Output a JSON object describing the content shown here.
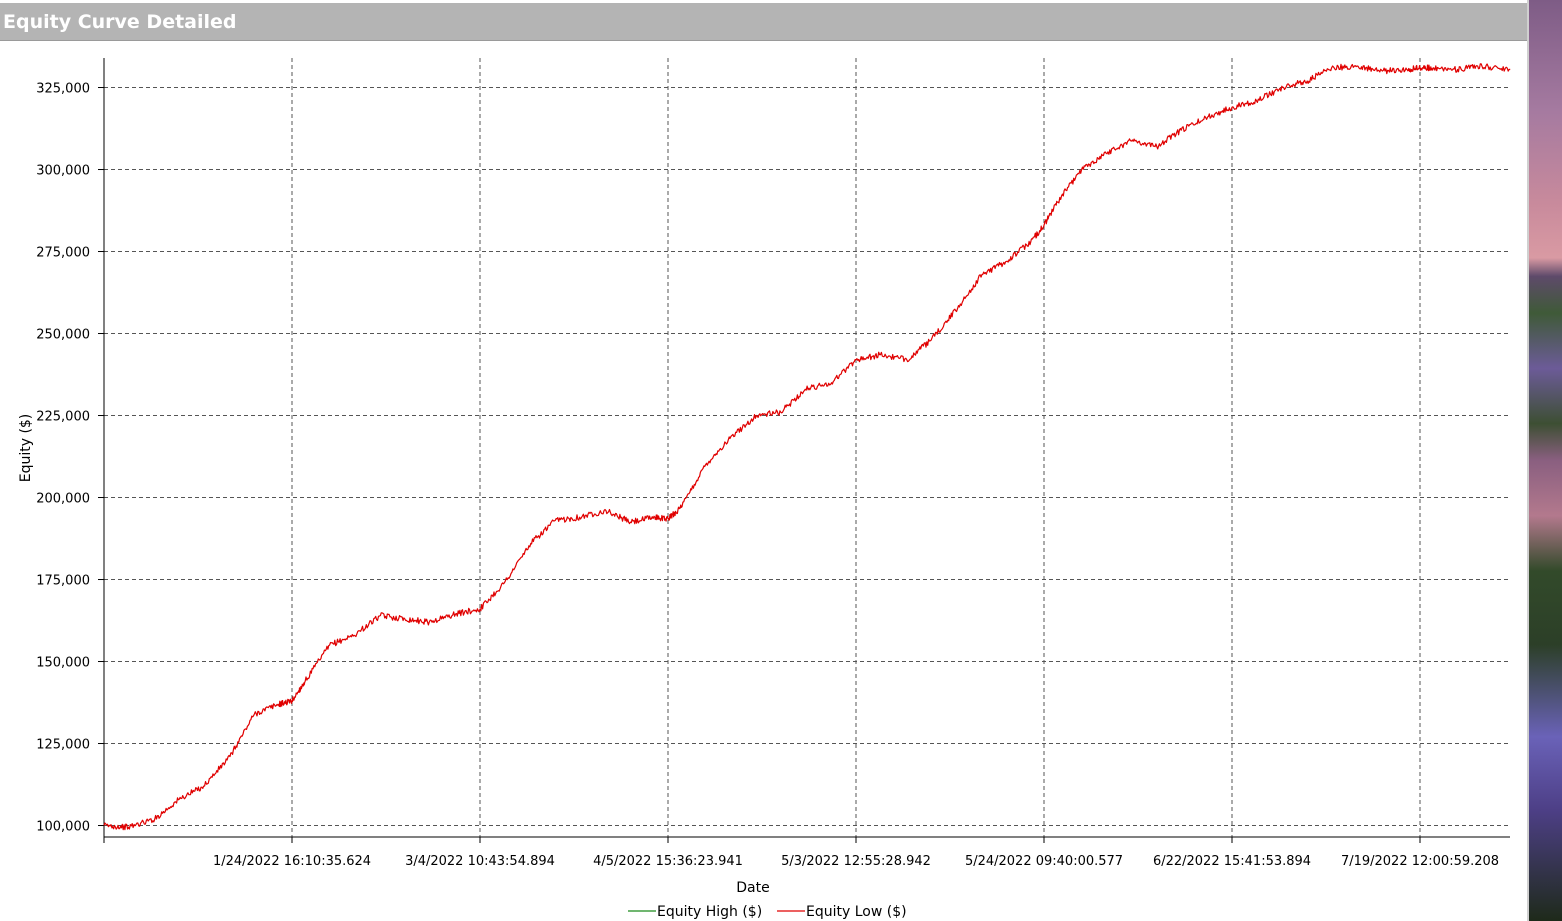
{
  "window": {
    "title": "Equity Curve Detailed"
  },
  "colors": {
    "title_bar": "#b4b4b4",
    "equity_high": "#1a8a1a",
    "equity_low": "#e00000",
    "grid": "#555555"
  },
  "chart_data": {
    "type": "line",
    "title": "",
    "xlabel": "Date",
    "ylabel": "Equity ($)",
    "ylim": [
      96500,
      334000
    ],
    "grid": true,
    "legend_position": "bottom-center",
    "y_ticks": [
      100000,
      125000,
      150000,
      175000,
      200000,
      225000,
      250000,
      275000,
      300000,
      325000
    ],
    "y_tick_labels": [
      "100,000",
      "125,000",
      "150,000",
      "175,000",
      "200,000",
      "225,000",
      "250,000",
      "275,000",
      "300,000",
      "325,000"
    ],
    "x_ticks": [
      1,
      2,
      3,
      4,
      5,
      6,
      7
    ],
    "x_tick_labels": [
      "1/24/2022 16:10:35.624",
      "3/4/2022 10:43:54.894",
      "4/5/2022 15:36:23.941",
      "5/3/2022 12:55:28.942",
      "5/24/2022 09:40:00.577",
      "6/22/2022 15:41:53.894",
      "7/19/2022 12:00:59.208"
    ],
    "x_range": [
      0,
      7.48
    ],
    "series": [
      {
        "name": "Equity High ($)",
        "x": [],
        "values": []
      },
      {
        "name": "Equity Low ($)",
        "x": [
          0,
          0.13,
          0.27,
          0.4,
          0.53,
          0.67,
          0.8,
          0.93,
          1.0,
          1.07,
          1.2,
          1.33,
          1.47,
          1.6,
          1.73,
          1.87,
          2.0,
          2.13,
          2.27,
          2.4,
          2.53,
          2.67,
          2.8,
          2.93,
          3.0,
          3.07,
          3.2,
          3.33,
          3.47,
          3.6,
          3.73,
          3.87,
          4.0,
          4.13,
          4.27,
          4.4,
          4.53,
          4.67,
          4.8,
          4.93,
          5.0,
          5.07,
          5.2,
          5.33,
          5.47,
          5.6,
          5.73,
          5.87,
          6.0,
          6.13,
          6.27,
          6.4,
          6.53,
          6.67,
          6.8,
          6.93,
          7.0,
          7.07,
          7.2,
          7.33,
          7.48
        ],
        "values": [
          100000,
          99500,
          102000,
          108000,
          112000,
          121000,
          134000,
          137000,
          138000,
          144000,
          155000,
          158000,
          164000,
          163000,
          162000,
          164500,
          166000,
          174000,
          186000,
          193000,
          194000,
          196000,
          192500,
          194000,
          193500,
          197000,
          210000,
          218000,
          225000,
          226000,
          233000,
          235000,
          242000,
          243500,
          242000,
          248000,
          257000,
          268000,
          272000,
          278000,
          283000,
          290000,
          300000,
          305000,
          309000,
          307000,
          312000,
          316000,
          319000,
          321000,
          325000,
          327000,
          331000,
          331500,
          330000,
          330500,
          331000,
          331000,
          330500,
          331500,
          330500
        ]
      }
    ]
  }
}
